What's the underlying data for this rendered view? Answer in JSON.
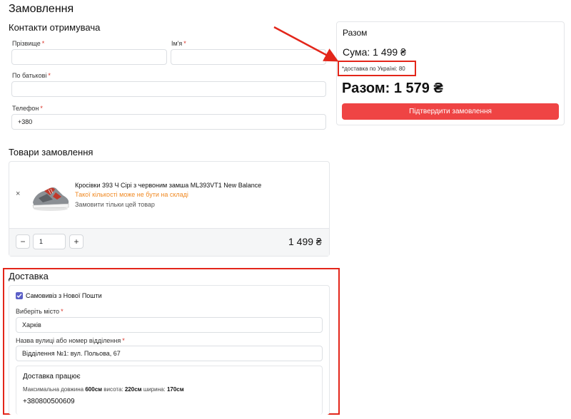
{
  "page": {
    "title": "Замовлення"
  },
  "contacts": {
    "title": "Контакти отримувача",
    "surname_label": "Прізвище",
    "name_label": "Ім'я",
    "patronymic_label": "По батькові",
    "phone_label": "Телефон",
    "required_mark": "*",
    "surname_value": "",
    "name_value": "",
    "patronymic_value": "",
    "phone_value": "+380"
  },
  "summary": {
    "title": "Разом",
    "sum_text": "Сума: 1 499 ₴",
    "delivery_note": "*доставка по Україні: 80",
    "total_text": "Разом: 1 579 ₴",
    "confirm_label": "Підтвердити замовлення"
  },
  "items": {
    "title": "Товари замовлення",
    "remove_glyph": "×",
    "product_name": "Кросівки 393 Ч Сірі з червоним замша ML393VT1 New Balance",
    "product_warning": "Такої кількості може не бути на складі",
    "product_link": "Замовити тільки цей товар",
    "minus_glyph": "−",
    "plus_glyph": "+",
    "quantity": "1",
    "price": "1 499 ₴"
  },
  "delivery": {
    "title": "Доставка",
    "pickup_label": "Самовивіз з Нової Пошти",
    "pickup_checked": true,
    "city_label": "Виберіть місто",
    "city_value": "Харків",
    "branch_label": "Назва вулиці або номер відділення",
    "branch_value": "Відділення №1: вул. Польова, 67",
    "work_title": "Доставка працює",
    "dims_prefix": "Максимальна довжина",
    "dims_length": "600см",
    "dims_height_label": "висота:",
    "dims_height": "220см",
    "dims_width_label": "ширина:",
    "dims_width": "170см",
    "phone": "+380800500609"
  },
  "colors": {
    "accent": "#ef4444",
    "annotation": "#e3261a",
    "warning": "#f08a24",
    "checkbox": "#5b5fc7"
  }
}
